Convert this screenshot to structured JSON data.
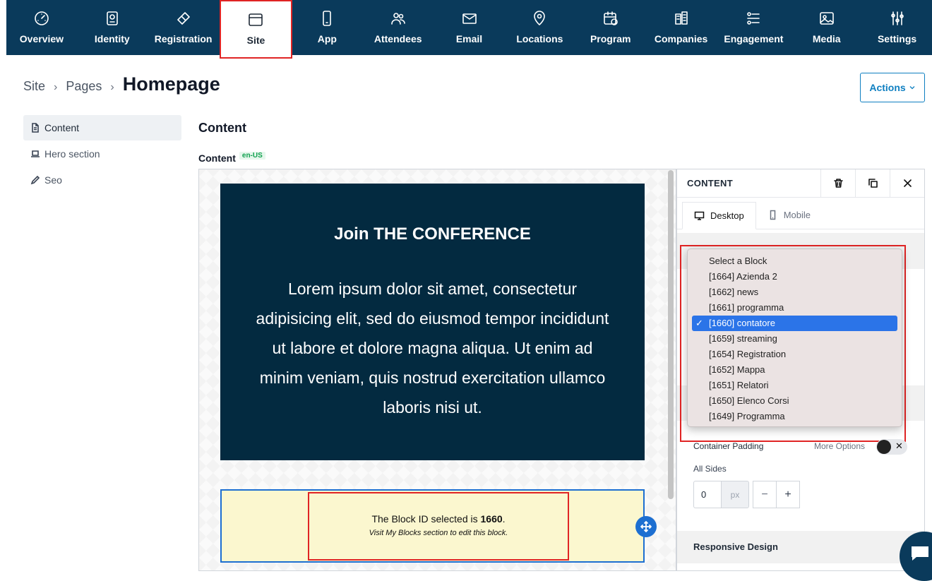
{
  "nav": {
    "items": [
      {
        "label": "Overview",
        "icon": "gauge-icon"
      },
      {
        "label": "Identity",
        "icon": "passport-icon"
      },
      {
        "label": "Registration",
        "icon": "ticket-icon"
      },
      {
        "label": "Site",
        "icon": "browser-window-icon"
      },
      {
        "label": "App",
        "icon": "phone-icon"
      },
      {
        "label": "Attendees",
        "icon": "people-icon"
      },
      {
        "label": "Email",
        "icon": "mail-icon"
      },
      {
        "label": "Locations",
        "icon": "map-pin-icon"
      },
      {
        "label": "Program",
        "icon": "calendar-clock-icon"
      },
      {
        "label": "Companies",
        "icon": "building-icon"
      },
      {
        "label": "Engagement",
        "icon": "engagement-icon"
      },
      {
        "label": "Media",
        "icon": "image-icon"
      },
      {
        "label": "Settings",
        "icon": "sliders-icon"
      }
    ],
    "active": "Site"
  },
  "breadcrumb": {
    "level1": "Site",
    "level2": "Pages",
    "title": "Homepage"
  },
  "actions_label": "Actions",
  "sidemenu": {
    "items": [
      {
        "label": "Content",
        "icon": "document-icon"
      },
      {
        "label": "Hero section",
        "icon": "laptop-icon"
      },
      {
        "label": "Seo",
        "icon": "pencil-icon"
      }
    ]
  },
  "content": {
    "heading": "Content",
    "field_label": "Content",
    "lang": "en-US"
  },
  "canvas": {
    "dark_title": "Join THE CONFERENCE",
    "dark_text": "Lorem ipsum dolor sit amet, consectetur adipisicing elit, sed do eiusmod tempor incididunt ut labore et dolore magna aliqua. Ut enim ad minim veniam, quis nostrud exercitation ullamco laboris nisi ut.",
    "block_text_prefix": "The Block ID selected is ",
    "block_id": "1660",
    "block_text_suffix": ".",
    "block_hint": "Visit My Blocks section to edit this block."
  },
  "panel": {
    "title": "CONTENT",
    "tabs": {
      "desktop": "Desktop",
      "mobile": "Mobile"
    },
    "dropdown": {
      "options": [
        "Select a Block",
        "[1664] Azienda 2",
        "[1662] news",
        "[1661] programma",
        "[1660] contatore",
        "[1659] streaming",
        "[1654] Registration",
        "[1652] Mappa",
        "[1651] Relatori",
        "[1650] Elenco Corsi",
        "[1649] Programma"
      ],
      "selected_index": 4,
      "check": "✓"
    },
    "container_padding": "Container Padding",
    "more_options": "More Options",
    "toggle_x": "✕",
    "all_sides": "All Sides",
    "padding_value": "0",
    "unit": "px",
    "minus": "−",
    "plus": "+",
    "responsive": "Responsive Design"
  }
}
